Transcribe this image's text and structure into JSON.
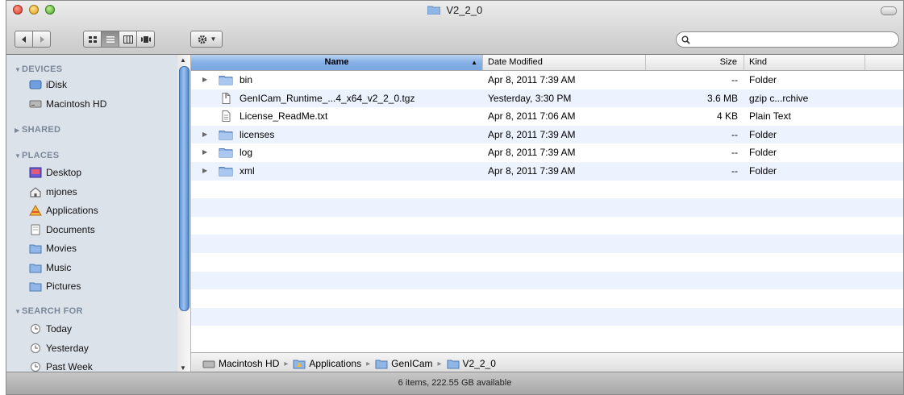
{
  "window": {
    "title": "V2_2_0"
  },
  "toolbar": {
    "back_icon": "back-arrow",
    "forward_icon": "forward-arrow",
    "view_modes": [
      "icon-view",
      "list-view",
      "column-view",
      "coverflow-view"
    ],
    "active_view": "list-view",
    "action_icon": "gear-icon",
    "search_placeholder": ""
  },
  "sidebar": {
    "sections": [
      {
        "label": "DEVICES",
        "items": [
          {
            "label": "iDisk",
            "icon": "idisk-icon"
          },
          {
            "label": "Macintosh HD",
            "icon": "harddrive-icon"
          }
        ]
      },
      {
        "label": "SHARED",
        "items": []
      },
      {
        "label": "PLACES",
        "items": [
          {
            "label": "Desktop",
            "icon": "desktop-icon"
          },
          {
            "label": "mjones",
            "icon": "home-icon"
          },
          {
            "label": "Applications",
            "icon": "applications-icon"
          },
          {
            "label": "Documents",
            "icon": "documents-icon"
          },
          {
            "label": "Movies",
            "icon": "folder-icon"
          },
          {
            "label": "Music",
            "icon": "folder-icon"
          },
          {
            "label": "Pictures",
            "icon": "folder-icon"
          }
        ]
      },
      {
        "label": "SEARCH FOR",
        "items": [
          {
            "label": "Today",
            "icon": "clock-icon"
          },
          {
            "label": "Yesterday",
            "icon": "clock-icon"
          },
          {
            "label": "Past Week",
            "icon": "clock-icon"
          }
        ]
      }
    ]
  },
  "columns": {
    "name": "Name",
    "date": "Date Modified",
    "size": "Size",
    "kind": "Kind"
  },
  "files": [
    {
      "name": "bin",
      "date": "Apr 8, 2011 7:39 AM",
      "size": "--",
      "kind": "Folder",
      "type": "folder"
    },
    {
      "name": "GenICam_Runtime_...4_x64_v2_2_0.tgz",
      "date": "Yesterday, 3:30 PM",
      "size": "3.6 MB",
      "kind": "gzip c...rchive",
      "type": "archive"
    },
    {
      "name": "License_ReadMe.txt",
      "date": "Apr 8, 2011 7:06 AM",
      "size": "4 KB",
      "kind": "Plain Text",
      "type": "text"
    },
    {
      "name": "licenses",
      "date": "Apr 8, 2011 7:39 AM",
      "size": "--",
      "kind": "Folder",
      "type": "folder"
    },
    {
      "name": "log",
      "date": "Apr 8, 2011 7:39 AM",
      "size": "--",
      "kind": "Folder",
      "type": "folder"
    },
    {
      "name": "xml",
      "date": "Apr 8, 2011 7:39 AM",
      "size": "--",
      "kind": "Folder",
      "type": "folder"
    }
  ],
  "path": [
    "Macintosh HD",
    "Applications",
    "GenICam",
    "V2_2_0"
  ],
  "status": "6 items, 222.55 GB available",
  "colors": {
    "selection_blue": "#7aa7e2",
    "sidebar_bg": "#dce2ea",
    "row_stripe": "#edf3fe"
  }
}
